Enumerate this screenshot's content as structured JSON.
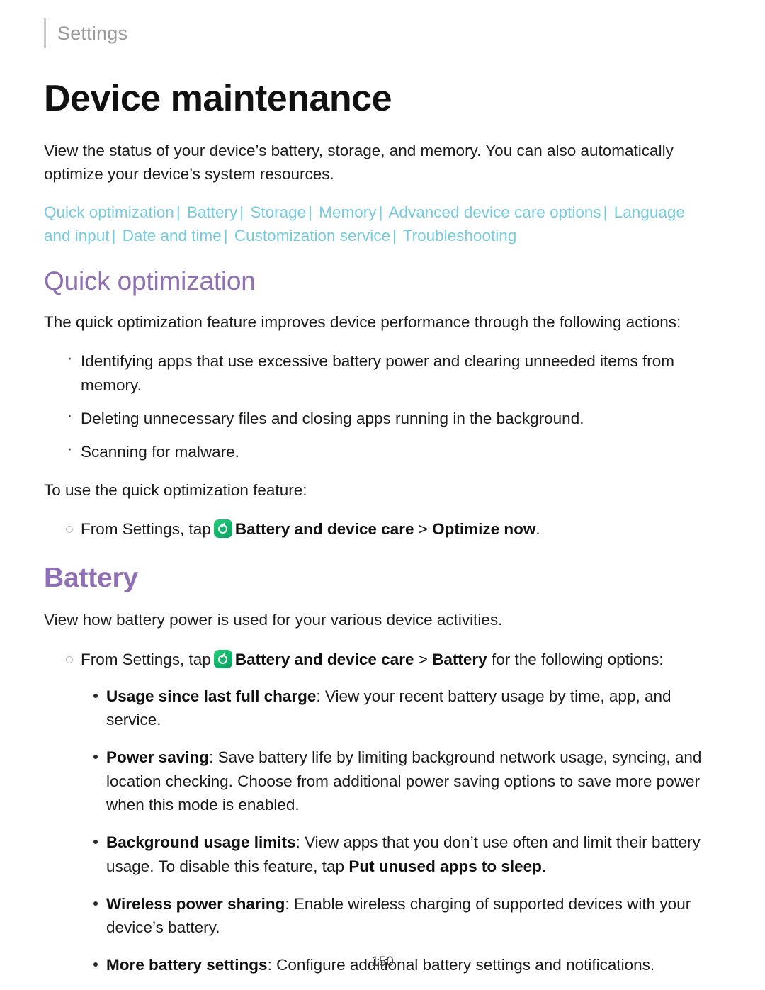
{
  "header": {
    "title": "Settings"
  },
  "page_title": "Device maintenance",
  "intro": "View the status of your device’s battery, storage, and memory. You can also automatically optimize your device’s system resources.",
  "linkbar": {
    "items": [
      "Quick optimization",
      "Battery",
      "Storage",
      "Memory",
      "Advanced device care options",
      "Language and input",
      "Date and time",
      "Customization service",
      "Troubleshooting"
    ],
    "separator": "|",
    "color": "#76cbe0"
  },
  "quick_optimization": {
    "heading": "Quick optimization",
    "intro": "The quick optimization feature improves device performance through the following actions:",
    "bullets": [
      "Identifying apps that use excessive battery power and clearing unneeded items from memory.",
      "Deleting unnecessary files and closing apps running in the background.",
      "Scanning for malware."
    ],
    "use_line": "To use the quick optimization feature:",
    "step": {
      "prefix": "From Settings, tap",
      "icon": "battery-device-care-icon",
      "bold_path": "Battery and device care",
      "separator": ">",
      "bold_action": "Optimize now",
      "suffix": "."
    }
  },
  "battery": {
    "heading": "Battery",
    "intro": "View how battery power is used for your various device activities.",
    "step": {
      "prefix": "From Settings, tap",
      "icon": "battery-device-care-icon",
      "bold_path": "Battery and device care",
      "separator": ">",
      "bold_target": "Battery",
      "suffix": "for the following options:"
    },
    "options": [
      {
        "term": "Usage since last full charge",
        "desc": ": View your recent battery usage by time, app, and service."
      },
      {
        "term": "Power saving",
        "desc": ": Save battery life by limiting background network usage, syncing, and location checking. Choose from additional power saving options to save more power when this mode is enabled."
      },
      {
        "term": "Background usage limits",
        "desc": ": View apps that you don’t use often and limit their battery usage. To disable this feature, tap ",
        "desc_bold": "Put unused apps to sleep",
        "desc_tail": "."
      },
      {
        "term": "Wireless power sharing",
        "desc": ": Enable wireless charging of supported devices with your device’s battery."
      },
      {
        "term": "More battery settings",
        "desc": ": Configure additional battery settings and notifications."
      }
    ]
  },
  "page_number": "150"
}
